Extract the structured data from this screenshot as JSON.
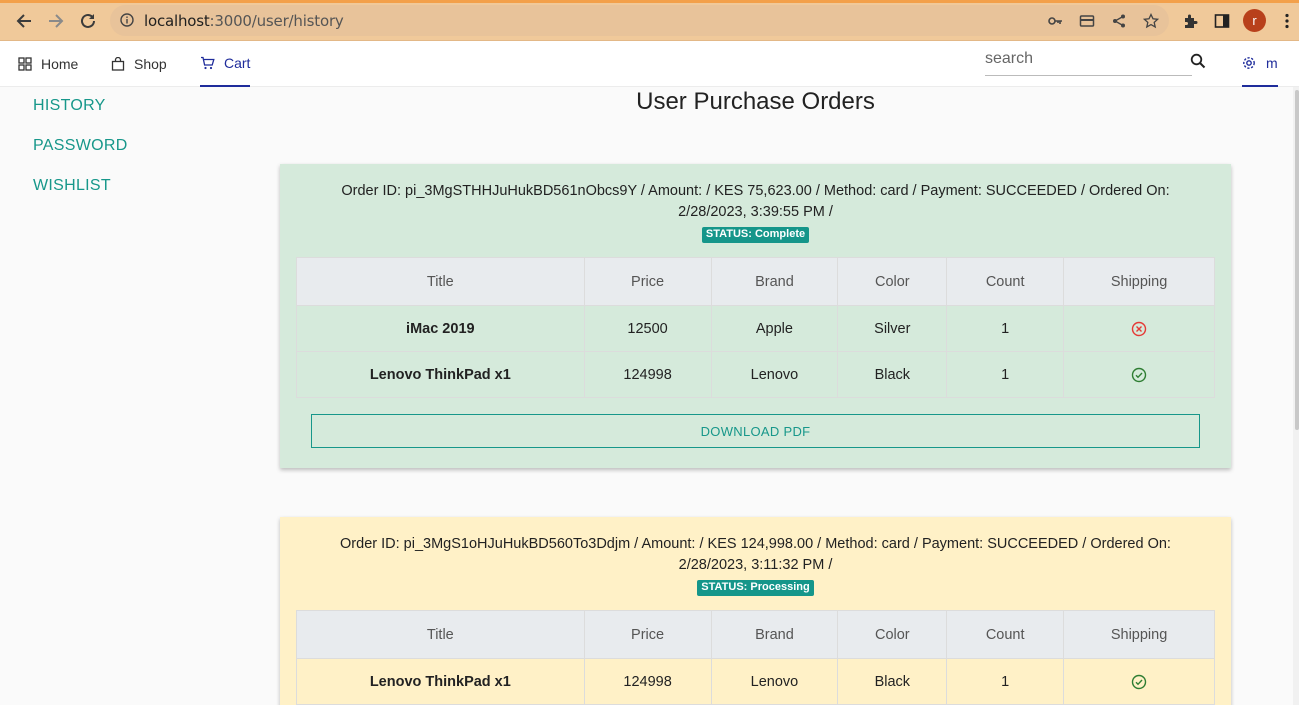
{
  "browser": {
    "url_host": "localhost",
    "url_path": ":3000/user/history",
    "avatar_letter": "r"
  },
  "nav": {
    "home": "Home",
    "shop": "Shop",
    "cart": "Cart",
    "search_placeholder": "search",
    "settings_label": "m"
  },
  "sidebar": {
    "items": [
      "HISTORY",
      "PASSWORD",
      "WISHLIST"
    ]
  },
  "page": {
    "title": "User Purchase Orders"
  },
  "orders": [
    {
      "info": "Order ID: pi_3MgSTHHJuHukBD561nObcs9Y / Amount: / KES 75,623.00 / Method: card / Payment: SUCCEEDED / Ordered On: 2/28/2023, 3:39:55 PM /",
      "status": "STATUS: Complete",
      "headers": [
        "Title",
        "Price",
        "Brand",
        "Color",
        "Count",
        "Shipping"
      ],
      "rows": [
        {
          "title": "iMac 2019",
          "price": "12500",
          "brand": "Apple",
          "color": "Silver",
          "count": "1",
          "shipping": "x-circle-icon"
        },
        {
          "title": "Lenovo ThinkPad x1",
          "price": "124998",
          "brand": "Lenovo",
          "color": "Black",
          "count": "1",
          "shipping": "check-circle-icon"
        }
      ],
      "download_label": "DOWNLOAD PDF"
    },
    {
      "info": "Order ID: pi_3MgS1oHJuHukBD560To3Ddjm / Amount: / KES 124,998.00 / Method: card / Payment: SUCCEEDED / Ordered On: 2/28/2023, 3:11:32 PM /",
      "status": "STATUS: Processing",
      "headers": [
        "Title",
        "Price",
        "Brand",
        "Color",
        "Count",
        "Shipping"
      ],
      "rows": [
        {
          "title": "Lenovo ThinkPad x1",
          "price": "124998",
          "brand": "Lenovo",
          "color": "Black",
          "count": "1",
          "shipping": "check-circle-icon"
        }
      ]
    }
  ],
  "colors": {
    "accent": "#17978a",
    "nav_active": "#1f2c9b",
    "complete_bg": "#d5eadb",
    "processing_bg": "#fff1c7",
    "error": "#e53935",
    "success": "#2e7d32"
  }
}
